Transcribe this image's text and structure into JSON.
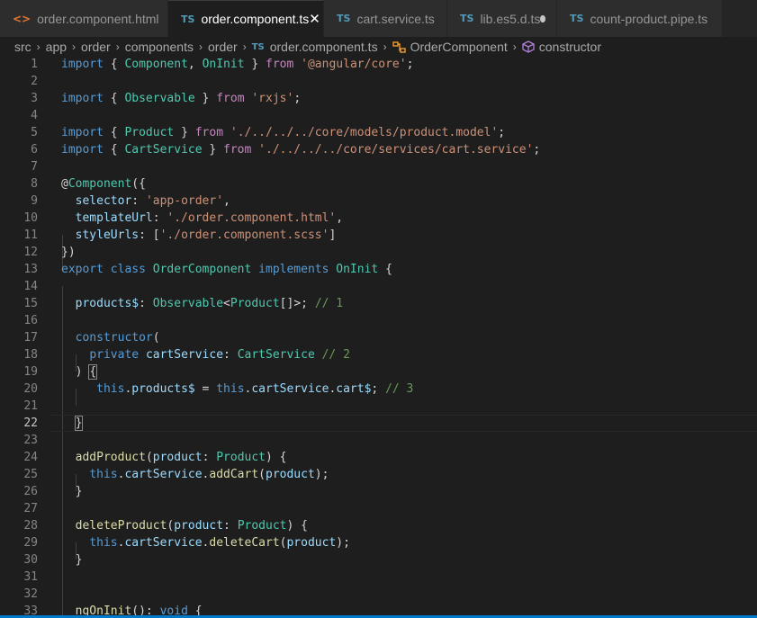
{
  "tabs": [
    {
      "icon": "<>",
      "label": "order.component.html",
      "active": false,
      "modified": true
    },
    {
      "icon": "TS",
      "label": "order.component.ts",
      "active": true,
      "modified": false
    },
    {
      "icon": "TS",
      "label": "cart.service.ts",
      "active": false,
      "modified": false
    },
    {
      "icon": "TS",
      "label": "lib.es5.d.ts",
      "active": false,
      "modified": true
    },
    {
      "icon": "TS",
      "label": "count-product.pipe.ts",
      "active": false,
      "modified": false
    }
  ],
  "breadcrumb": [
    "src",
    "app",
    "order",
    "components",
    "order",
    "order.component.ts",
    "OrderComponent",
    "constructor"
  ],
  "editor": {
    "current_line": 22,
    "lines": [
      [
        [
          "kw",
          "import"
        ],
        [
          "pn",
          " { "
        ],
        [
          "ty",
          "Component"
        ],
        [
          "pn",
          ", "
        ],
        [
          "ty",
          "OnInit"
        ],
        [
          "pn",
          " } "
        ],
        [
          "ctl",
          "from"
        ],
        [
          "pn",
          " "
        ],
        [
          "str",
          "'@angular/core'"
        ],
        [
          "pn",
          ";"
        ]
      ],
      [],
      [
        [
          "kw",
          "import"
        ],
        [
          "pn",
          " { "
        ],
        [
          "ty",
          "Observable"
        ],
        [
          "pn",
          " } "
        ],
        [
          "ctl",
          "from"
        ],
        [
          "pn",
          " "
        ],
        [
          "str",
          "'rxjs'"
        ],
        [
          "pn",
          ";"
        ]
      ],
      [],
      [
        [
          "kw",
          "import"
        ],
        [
          "pn",
          " { "
        ],
        [
          "ty",
          "Product"
        ],
        [
          "pn",
          " } "
        ],
        [
          "ctl",
          "from"
        ],
        [
          "pn",
          " "
        ],
        [
          "str",
          "'./../../../core/models/product.model'"
        ],
        [
          "pn",
          ";"
        ]
      ],
      [
        [
          "kw",
          "import"
        ],
        [
          "pn",
          " { "
        ],
        [
          "ty",
          "CartService"
        ],
        [
          "pn",
          " } "
        ],
        [
          "ctl",
          "from"
        ],
        [
          "pn",
          " "
        ],
        [
          "str",
          "'./../../../core/services/cart.service'"
        ],
        [
          "pn",
          ";"
        ]
      ],
      [],
      [
        [
          "pn",
          "@"
        ],
        [
          "ty",
          "Component"
        ],
        [
          "pn",
          "({"
        ]
      ],
      [
        [
          "pn",
          "  "
        ],
        [
          "vr",
          "selector"
        ],
        [
          "pn",
          ": "
        ],
        [
          "str",
          "'app-order'"
        ],
        [
          "pn",
          ","
        ]
      ],
      [
        [
          "pn",
          "  "
        ],
        [
          "vr",
          "templateUrl"
        ],
        [
          "pn",
          ": "
        ],
        [
          "str",
          "'./order.component.html'"
        ],
        [
          "pn",
          ","
        ]
      ],
      [
        [
          "pn",
          "  "
        ],
        [
          "vr",
          "styleUrls"
        ],
        [
          "pn",
          ": ["
        ],
        [
          "str",
          "'./order.component.scss'"
        ],
        [
          "pn",
          "]"
        ]
      ],
      [
        [
          "pn",
          "})"
        ]
      ],
      [
        [
          "kw",
          "export"
        ],
        [
          "pn",
          " "
        ],
        [
          "kw",
          "class"
        ],
        [
          "pn",
          " "
        ],
        [
          "ty",
          "OrderComponent"
        ],
        [
          "pn",
          " "
        ],
        [
          "kw",
          "implements"
        ],
        [
          "pn",
          " "
        ],
        [
          "ty",
          "OnInit"
        ],
        [
          "pn",
          " {"
        ]
      ],
      [],
      [
        [
          "pn",
          "  "
        ],
        [
          "vr",
          "products$"
        ],
        [
          "pn",
          ": "
        ],
        [
          "ty",
          "Observable"
        ],
        [
          "pn",
          "<"
        ],
        [
          "ty",
          "Product"
        ],
        [
          "pn",
          "[]>; "
        ],
        [
          "cm",
          "// 1"
        ]
      ],
      [],
      [
        [
          "pn",
          "  "
        ],
        [
          "kw",
          "constructor"
        ],
        [
          "pn",
          "("
        ]
      ],
      [
        [
          "pn",
          "    "
        ],
        [
          "kw",
          "private"
        ],
        [
          "pn",
          " "
        ],
        [
          "vr",
          "cartService"
        ],
        [
          "pn",
          ": "
        ],
        [
          "ty",
          "CartService"
        ],
        [
          "pn",
          " "
        ],
        [
          "cm",
          "// 2"
        ]
      ],
      [
        [
          "pn",
          "  ) "
        ],
        [
          "bm",
          "{"
        ]
      ],
      [
        [
          "pn",
          "     "
        ],
        [
          "kw",
          "this"
        ],
        [
          "pn",
          "."
        ],
        [
          "vr",
          "products$"
        ],
        [
          "pn",
          " = "
        ],
        [
          "kw",
          "this"
        ],
        [
          "pn",
          "."
        ],
        [
          "vr",
          "cartService"
        ],
        [
          "pn",
          "."
        ],
        [
          "vr",
          "cart$"
        ],
        [
          "pn",
          "; "
        ],
        [
          "cm",
          "// 3"
        ]
      ],
      [],
      [
        [
          "pn",
          "  "
        ],
        [
          "bm",
          "}"
        ]
      ],
      [],
      [
        [
          "pn",
          "  "
        ],
        [
          "fn",
          "addProduct"
        ],
        [
          "pn",
          "("
        ],
        [
          "vr",
          "product"
        ],
        [
          "pn",
          ": "
        ],
        [
          "ty",
          "Product"
        ],
        [
          "pn",
          ") {"
        ]
      ],
      [
        [
          "pn",
          "    "
        ],
        [
          "kw",
          "this"
        ],
        [
          "pn",
          "."
        ],
        [
          "vr",
          "cartService"
        ],
        [
          "pn",
          "."
        ],
        [
          "fn",
          "addCart"
        ],
        [
          "pn",
          "("
        ],
        [
          "vr",
          "product"
        ],
        [
          "pn",
          ");"
        ]
      ],
      [
        [
          "pn",
          "  }"
        ]
      ],
      [],
      [
        [
          "pn",
          "  "
        ],
        [
          "fn",
          "deleteProduct"
        ],
        [
          "pn",
          "("
        ],
        [
          "vr",
          "product"
        ],
        [
          "pn",
          ": "
        ],
        [
          "ty",
          "Product"
        ],
        [
          "pn",
          ") {"
        ]
      ],
      [
        [
          "pn",
          "    "
        ],
        [
          "kw",
          "this"
        ],
        [
          "pn",
          "."
        ],
        [
          "vr",
          "cartService"
        ],
        [
          "pn",
          "."
        ],
        [
          "fn",
          "deleteCart"
        ],
        [
          "pn",
          "("
        ],
        [
          "vr",
          "product"
        ],
        [
          "pn",
          ");"
        ]
      ],
      [
        [
          "pn",
          "  }"
        ]
      ],
      [],
      [],
      [
        [
          "pn",
          "  "
        ],
        [
          "fn",
          "ngOnInit"
        ],
        [
          "pn",
          "(): "
        ],
        [
          "kw",
          "void"
        ],
        [
          "pn",
          " {"
        ]
      ]
    ]
  },
  "colors": {
    "accent": "#007acc",
    "background": "#1e1e1e",
    "tab_bar": "#252526"
  }
}
